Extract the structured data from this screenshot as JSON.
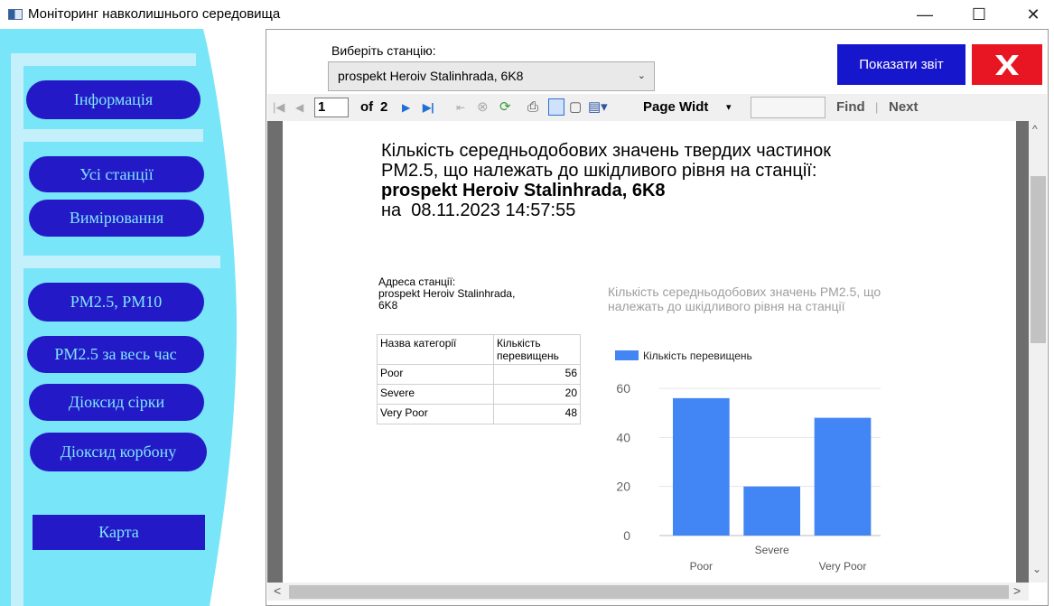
{
  "window": {
    "title": "Моніторинг навколишнього середовища",
    "minimize": "—",
    "maximize": "☐",
    "close": "✕"
  },
  "sidebar": {
    "items": [
      {
        "label": "Інформація"
      },
      {
        "label": "Усі станції"
      },
      {
        "label": "Вимірювання"
      },
      {
        "label": "PM2.5, PM10"
      },
      {
        "label": "PM2.5 за весь час"
      },
      {
        "label": "Діоксид сірки"
      },
      {
        "label": "Діоксид корбону"
      },
      {
        "label": "Карта"
      }
    ]
  },
  "header": {
    "station_label": "Виберіть станцію:",
    "station_value": "prospekt Heroiv Stalinhrada, 6K8",
    "show_report": "Показати звіт",
    "close_mark": "X"
  },
  "toolbar": {
    "page_input": "1",
    "of_label": "of",
    "total_pages": "2",
    "zoom": "Page Widt",
    "find": "Find",
    "separator": "|",
    "next": "Next"
  },
  "report": {
    "title_line1": "Кількість середньодобових значень твердих частинок",
    "title_line2": "PM2.5, що належать до шкідливого рівня на станції:",
    "station": "prospekt Heroiv Stalinhrada, 6K8",
    "date_prefix": "на",
    "date": "08.11.2023 14:57:55",
    "address_label": "Адреса станції:",
    "address_line1": "prospekt Heroiv Stalinhrada,",
    "address_line2": "6K8",
    "table": {
      "headers": [
        "Назва категорії",
        "Кількість перевищень"
      ],
      "rows": [
        [
          "Poor",
          "56"
        ],
        [
          "Severe",
          "20"
        ],
        [
          "Very Poor",
          "48"
        ]
      ]
    }
  },
  "chart_data": {
    "type": "bar",
    "title": "Кількість середньодобових значень PM2.5, що належать до шкідливого рівня на станції",
    "categories": [
      "Poor",
      "Severe",
      "Very Poor"
    ],
    "series": [
      {
        "name": "Кількість перевищень",
        "values": [
          56,
          20,
          48
        ]
      }
    ],
    "ylim": [
      0,
      60
    ],
    "yticks": [
      "0",
      "20",
      "40",
      "60"
    ],
    "grid": true,
    "legend": "top-left",
    "color": "#4285f4"
  }
}
